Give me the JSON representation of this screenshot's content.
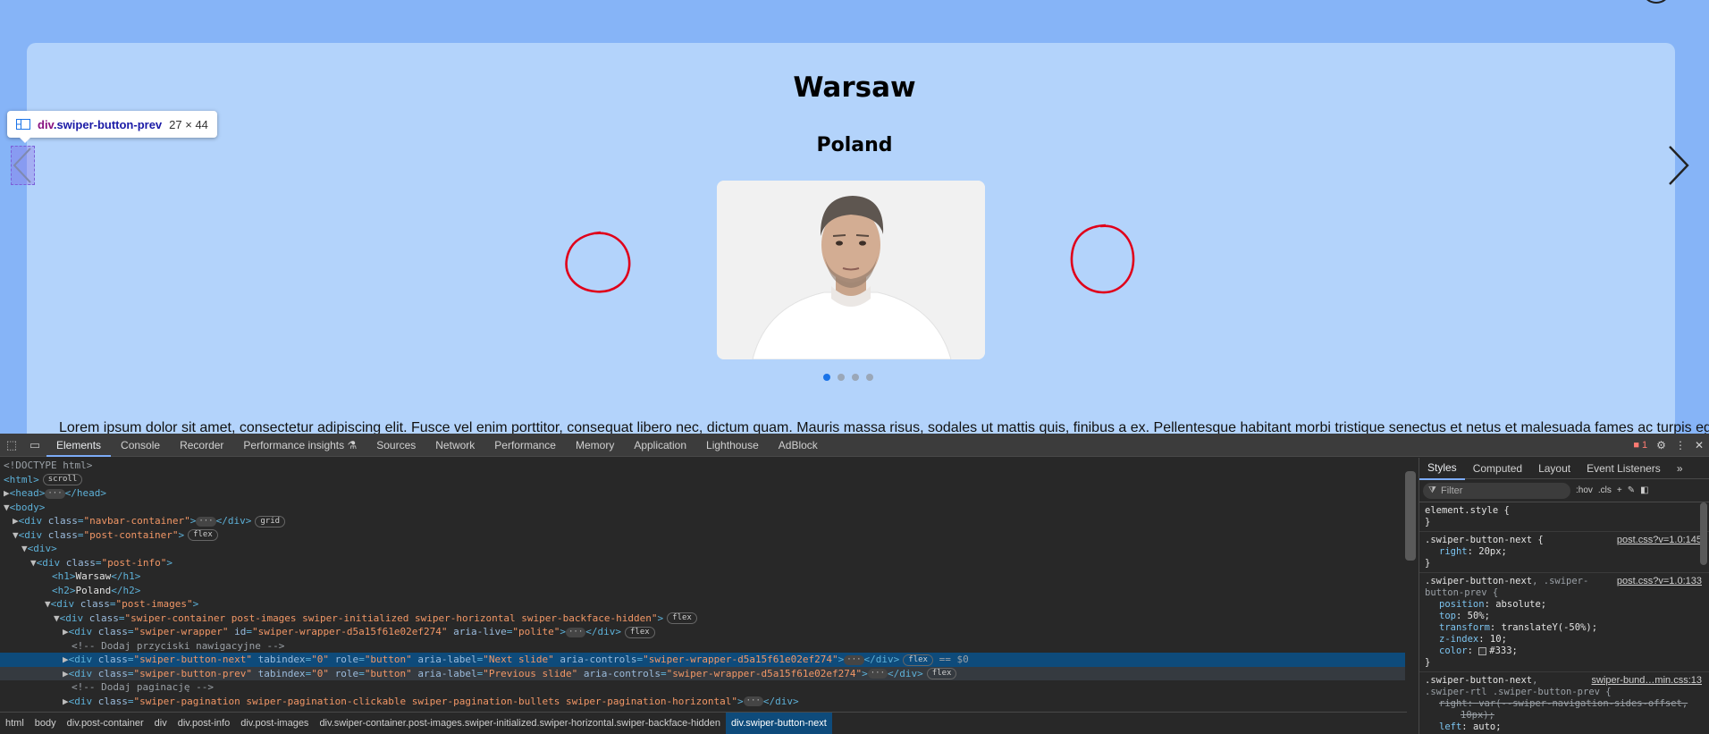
{
  "page": {
    "city": "Warsaw",
    "country": "Poland",
    "body_text": "Lorem ipsum dolor sit amet, consectetur adipiscing elit. Fusce vel enim porttitor, consequat libero nec, dictum quam. Mauris massa risus, sodales ut mattis quis, finibus a ex. Pellentesque habitant morbi tristique senectus et netus et malesuada fames ac turpis egestas.",
    "slide_count": 4,
    "active_slide": 0,
    "accent_color": "#1a73e8",
    "annotation_color": "#e0001a"
  },
  "inspector_tooltip": {
    "tag": "div",
    "class": ".swiper-button-prev",
    "size": "27 × 44"
  },
  "devtools": {
    "tabs": [
      "Elements",
      "Console",
      "Recorder",
      "Performance insights ⚗",
      "Sources",
      "Network",
      "Performance",
      "Memory",
      "Application",
      "Lighthouse",
      "AdBlock"
    ],
    "active_tab": "Elements",
    "error_count": "1",
    "dom": {
      "doctype": "<!DOCTYPE html>",
      "html_open": "<html>",
      "badge_scroll": "scroll",
      "head": "<head>",
      "head_close": "</head>",
      "body_open": "<body>",
      "badge_grid": "grid",
      "badge_flex": "flex",
      "ellipsis": "···",
      "sel_suffix": "== $0",
      "h1_text": "Warsaw",
      "h2_text": "Poland",
      "comment_nav": "<!-- Dodaj przyciski nawigacyjne -->",
      "comment_pag": "<!-- Dodaj paginację -->",
      "class_navbar": "\"navbar-container\"",
      "class_post_container": "\"post-container\"",
      "class_post_info": "\"post-info\"",
      "class_post_images": "\"post-images\"",
      "class_swiper_container": "\"swiper-container post-images swiper-initialized swiper-horizontal swiper-backface-hidden\"",
      "class_swiper_wrapper": "\"swiper-wrapper\"",
      "id_swiper_wrapper": "\"swiper-wrapper-d5a15f61e02ef274\"",
      "aria_live": "\"polite\"",
      "class_next": "\"swiper-button-next\"",
      "class_prev": "\"swiper-button-prev\"",
      "tabindex": "\"0\"",
      "role": "\"button\"",
      "label_next": "\"Next slide\"",
      "label_prev": "\"Previous slide\"",
      "aria_controls": "\"swiper-wrapper-d5a15f61e02ef274\"",
      "class_pagination": "\"swiper-pagination swiper-pagination-clickable swiper-pagination-bullets swiper-pagination-horizontal\""
    },
    "breadcrumbs": [
      "html",
      "body",
      "div.post-container",
      "div",
      "div.post-info",
      "div.post-images",
      "div.swiper-container.post-images.swiper-initialized.swiper-horizontal.swiper-backface-hidden",
      "div.swiper-button-next"
    ],
    "styles": {
      "tabs": [
        "Styles",
        "Computed",
        "Layout",
        "Event Listeners"
      ],
      "filter_placeholder": "Filter",
      "hov": ":hov",
      "cls": ".cls",
      "element_style": "element.style {",
      "close_brace": "}",
      "rule1_selector": ".swiper-button-next {",
      "rule1_source": "post.css?v=1.0:145",
      "rule1_prop": "right",
      "rule1_val": "20px;",
      "rule2_selector_a": ".swiper-button-next",
      "rule2_selector_b": ", .swiper-",
      "rule2_selector_c": "button-prev {",
      "rule2_source": "post.css?v=1.0:133",
      "rule2_props": [
        {
          "name": "position",
          "value": "absolute;"
        },
        {
          "name": "top",
          "value": "50%;"
        },
        {
          "name": "transform",
          "value": "translateY(-50%);"
        },
        {
          "name": "z-index",
          "value": "10;"
        },
        {
          "name": "color",
          "value": "#333;"
        }
      ],
      "rule3_selector_a": ".swiper-button-next",
      "rule3_selector_b": ",",
      "rule3_selector_c": ".swiper-rtl .swiper-button-prev {",
      "rule3_source": "swiper-bund…min.css:13",
      "rule3_prop": "right",
      "rule3_val": "var(--swiper-navigation-sides-offset,",
      "rule3_val2": "10px);",
      "rule3_prop2": "left",
      "rule3_val3": "auto;"
    }
  }
}
